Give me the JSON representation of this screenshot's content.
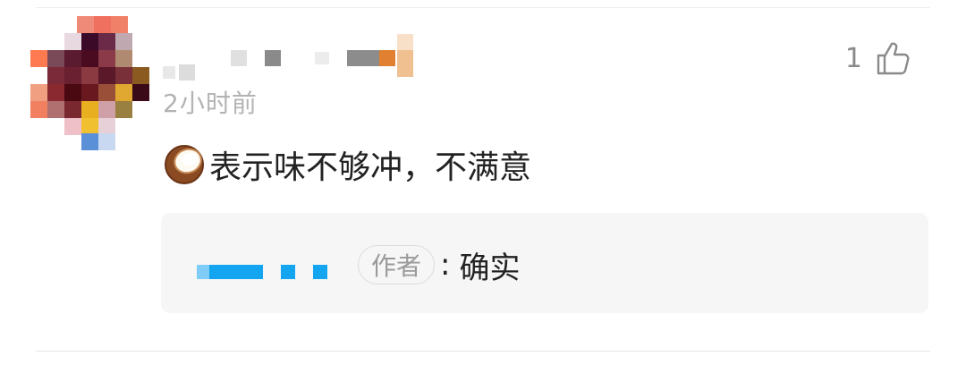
{
  "comment": {
    "timestamp": "2小时前",
    "like_count": "1",
    "body_text": "表示味不够冲，不满意",
    "emoji_icon": "coconut-icon",
    "like_icon": "thumbs-up-icon"
  },
  "reply": {
    "author_badge": "作者",
    "separator": ":",
    "text": "确实"
  },
  "colors": {
    "reply_username": "#14a5f0",
    "timestamp": "#b3b3b3",
    "reply_background": "#f6f6f6"
  }
}
